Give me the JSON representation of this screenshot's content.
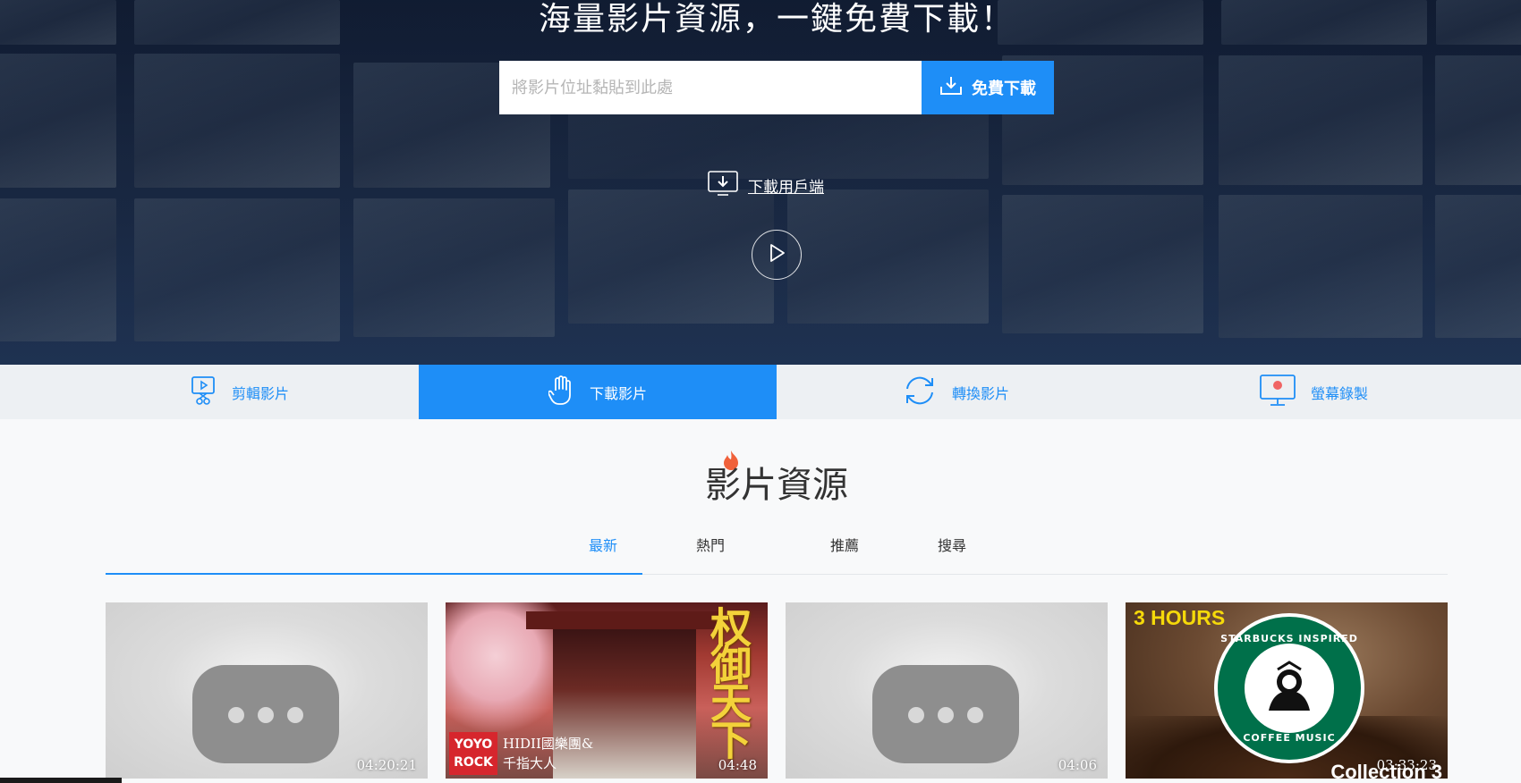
{
  "hero": {
    "title": "海量影片資源，一鍵免費下載！",
    "search": {
      "placeholder": "將影片位址黏貼到此處",
      "value": ""
    },
    "download_button": "免費下載",
    "client_link": "下載用戶端"
  },
  "tools": [
    {
      "label": "剪輯影片",
      "icon": "video-edit-icon",
      "active": false
    },
    {
      "label": "下載影片",
      "icon": "hand-icon",
      "active": true
    },
    {
      "label": "轉換影片",
      "icon": "convert-icon",
      "active": false
    },
    {
      "label": "螢幕錄製",
      "icon": "screen-record-icon",
      "active": false
    }
  ],
  "section": {
    "title": "影片資源",
    "tabs": [
      {
        "label": "最新",
        "active": true
      },
      {
        "label": "熱門",
        "active": false
      },
      {
        "label": "推薦",
        "active": false
      },
      {
        "label": "搜尋",
        "active": false
      }
    ]
  },
  "videos": [
    {
      "duration": "04:20:21",
      "thumbnail": "placeholder"
    },
    {
      "duration": "04:48",
      "thumbnail": "rock",
      "overlay": {
        "title": "权御天下",
        "badge": "YOYO ROCK",
        "subtitle_line1": "HIDII國樂團&",
        "subtitle_line2": "千指大人"
      }
    },
    {
      "duration": "04:06",
      "thumbnail": "placeholder"
    },
    {
      "duration": "03:33:23",
      "thumbnail": "coffee",
      "overlay": {
        "hours": "3 HOURS",
        "ring_top": "STARBUCKS INSPIRED",
        "ring_bottom": "COFFEE MUSIC",
        "collection": "Collection 3"
      }
    }
  ],
  "colors": {
    "accent": "#1e8ef7",
    "hero_bg": "#1c2c48",
    "toolbar_bg": "#edf0f3"
  }
}
